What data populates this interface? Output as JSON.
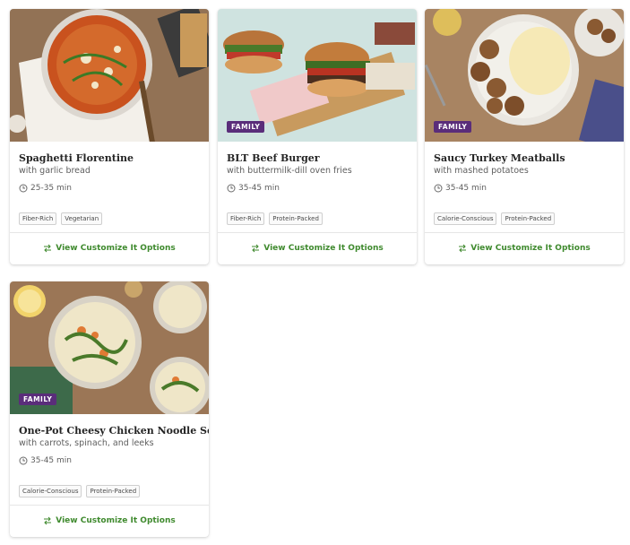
{
  "colors": {
    "accent_green": "#3f8a2e",
    "family_purple": "#5a2d7a"
  },
  "recipes": [
    {
      "title": "Spaghetti Florentine",
      "subtitle": "with garlic bread",
      "time": "25-35 min",
      "badge": "",
      "tags": [
        "Fiber-Rich",
        "Vegetarian"
      ],
      "action": "View Customize It Options",
      "image_icon": "spaghetti-photo"
    },
    {
      "title": "BLT Beef Burger",
      "subtitle": "with buttermilk-dill oven fries",
      "time": "35-45 min",
      "badge": "FAMILY",
      "tags": [
        "Fiber-Rich",
        "Protein-Packed"
      ],
      "action": "View Customize It Options",
      "image_icon": "burger-photo"
    },
    {
      "title": "Saucy Turkey Meatballs",
      "subtitle": "with mashed potatoes",
      "time": "35-45 min",
      "badge": "FAMILY",
      "tags": [
        "Calorie-Conscious",
        "Protein-Packed"
      ],
      "action": "View Customize It Options",
      "image_icon": "meatballs-photo"
    },
    {
      "title": "One-Pot Cheesy Chicken Noodle Soup",
      "subtitle": "with carrots, spinach, and leeks",
      "time": "35-45 min",
      "badge": "FAMILY",
      "tags": [
        "Calorie-Conscious",
        "Protein-Packed"
      ],
      "action": "View Customize It Options",
      "image_icon": "soup-photo"
    }
  ]
}
